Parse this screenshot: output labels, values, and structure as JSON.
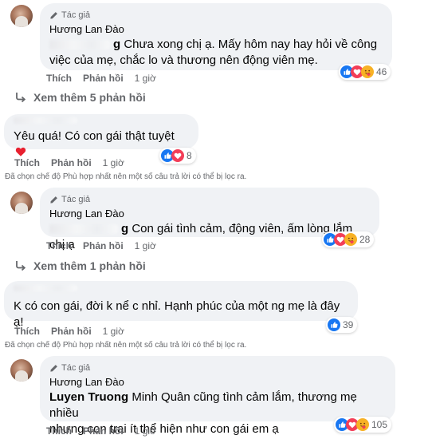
{
  "labels": {
    "author_badge": "Tác giả",
    "like": "Thích",
    "reply": "Phản hồi"
  },
  "filter_note": "Đã chọn chế độ Phù hợp nhất nên một số câu trả lời có thể bị lọc ra.",
  "comments": [
    {
      "author": "Hương Lan Đào",
      "mention_suffix": "g",
      "text_line1": "Chưa xong chị ạ. Mấy hôm nay hay hỏi về công",
      "text_line2": "việc của mẹ, chắc lo và thương nên động viên mẹ.",
      "time": "1 giờ",
      "reaction_count": "46",
      "reactions": [
        "like-icon",
        "love-icon",
        "care-icon"
      ]
    },
    {
      "see_more": "Xem thêm 5 phản hồi"
    },
    {
      "text": "Yêu quá! Có con gái thật tuyệt",
      "emoji": "heart-emoji",
      "time": "1 giờ",
      "reaction_count": "8",
      "reactions": [
        "like-icon",
        "love-icon"
      ]
    },
    {
      "author": "Hương Lan Đào",
      "mention_suffix": "g",
      "text": "Con gái tình cảm, động viên, ấm lòng lắm chị ạ",
      "time": "1 giờ",
      "reaction_count": "28",
      "reactions": [
        "like-icon",
        "love-icon",
        "care-icon"
      ]
    },
    {
      "see_more": "Xem thêm 1 phản hồi"
    },
    {
      "text": "K có con gái, đời k nể c nhỉ. Hạnh phúc của một ng mẹ là đây ạ!",
      "time": "1 giờ",
      "reaction_count": "39",
      "reactions": [
        "like-icon"
      ]
    },
    {
      "author": "Hương Lan Đào",
      "mention": "Luyen Truong",
      "text_line1": "Minh Quân cũng tình cảm lắm, thương mẹ nhiều",
      "text_line2": "nhưng con trai ít thể hiện như con gái em ạ",
      "time": "1 giờ",
      "reaction_count": "105",
      "reactions": [
        "like-icon",
        "love-icon",
        "care-icon"
      ]
    }
  ],
  "colors": {
    "bubble": "#f0f2f5",
    "secondary_text": "#65676b",
    "like_blue": "#1877f2",
    "love_red": "#f33e58",
    "care_yellow": "#f7b125"
  }
}
